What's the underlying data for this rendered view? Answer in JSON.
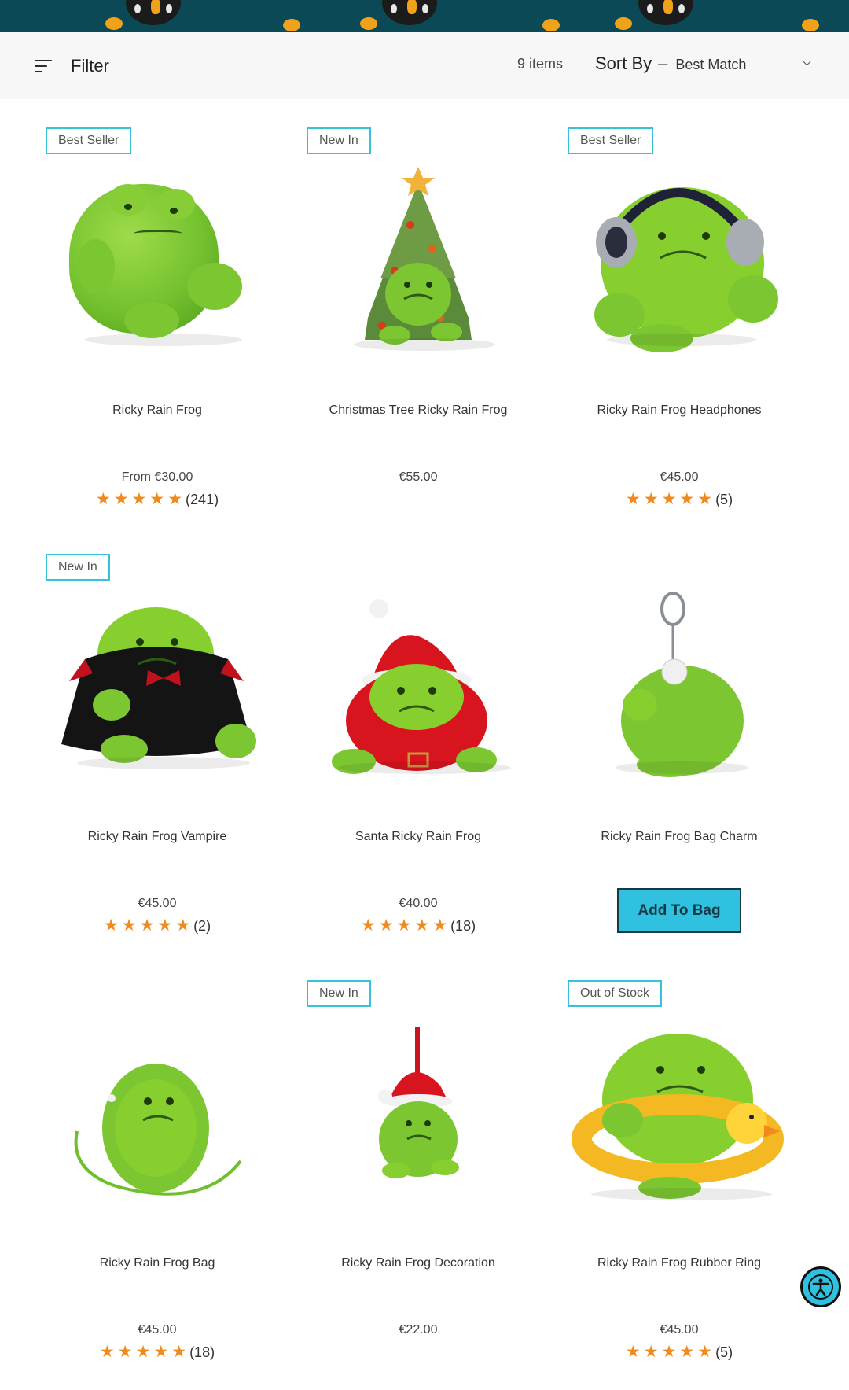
{
  "toolbar": {
    "filter_label": "Filter",
    "item_count": "9 items",
    "sort_label": "Sort By",
    "sort_dash": "–",
    "sort_value": "Best Match"
  },
  "products": [
    {
      "badge": "Best Seller",
      "title": "Ricky Rain Frog",
      "price": "From €30.00",
      "reviews": "(241)",
      "rating": 5
    },
    {
      "badge": "New In",
      "title": "Christmas Tree Ricky Rain Frog",
      "price": "€55.00"
    },
    {
      "badge": "Best Seller",
      "title": "Ricky Rain Frog Headphones",
      "price": "€45.00",
      "reviews": "(5)",
      "rating": 5
    },
    {
      "badge": "New In",
      "title": "Ricky Rain Frog Vampire",
      "price": "€45.00",
      "reviews": "(2)",
      "rating": 5
    },
    {
      "title": "Santa Ricky Rain Frog",
      "price": "€40.00",
      "reviews": "(18)",
      "rating": 5
    },
    {
      "title": "Ricky Rain Frog Bag Charm",
      "button": "Add To Bag"
    },
    {
      "title": "Ricky Rain Frog Bag",
      "price": "€45.00",
      "reviews": "(18)",
      "rating": 5
    },
    {
      "badge": "New In",
      "title": "Ricky Rain Frog Decoration",
      "price": "€22.00"
    },
    {
      "badge": "Out of Stock",
      "title": "Ricky Rain Frog Rubber Ring",
      "price": "€45.00",
      "reviews": "(5)",
      "rating": 5
    }
  ],
  "stars_glyph": "★★★★★",
  "colors": {
    "accent": "#2fc1df",
    "star": "#f08a1c",
    "banner": "#0b4957"
  },
  "icons": {
    "filter": "filter-lines-icon",
    "sort": "chevron-down-icon",
    "accessibility": "accessibility-icon"
  }
}
